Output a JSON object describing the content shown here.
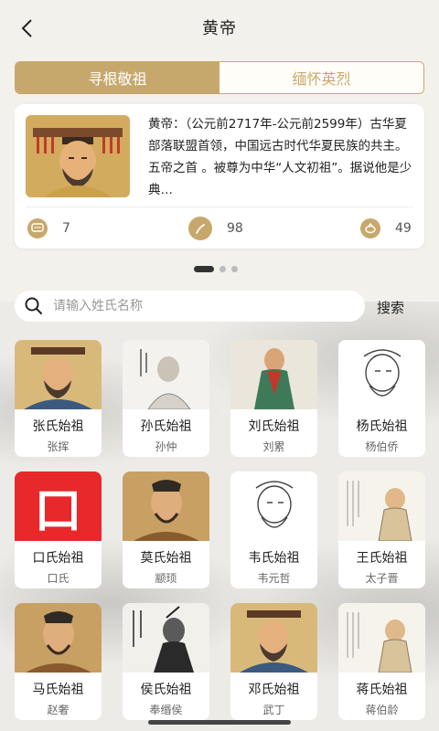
{
  "header": {
    "title": "黄帝"
  },
  "tabs": [
    {
      "label": "寻根敬祖"
    },
    {
      "label": "缅怀英烈"
    }
  ],
  "featured": {
    "description": "黄帝：（公元前2717年-公元前2599年）古华夏部落联盟首领，中国远古时代华夏民族的共主。五帝之首 。被尊为中华“人文初祖”。据说他是少典…",
    "stats": {
      "comments": "7",
      "likes": "98",
      "flowers": "49"
    }
  },
  "search": {
    "placeholder": "请输入姓氏名称",
    "button": "搜索"
  },
  "ancestors": [
    {
      "name": "张氏始祖",
      "person": "张挥",
      "art": "emperor"
    },
    {
      "name": "孙氏始祖",
      "person": "孙仲",
      "art": "sketch"
    },
    {
      "name": "刘氏始祖",
      "person": "刘累",
      "art": "robe"
    },
    {
      "name": "杨氏始祖",
      "person": "杨伯侨",
      "art": "lineart"
    },
    {
      "name": "口氏始祖",
      "person": "口氏",
      "art": "red-glyph",
      "glyph": "口"
    },
    {
      "name": "莫氏始祖",
      "person": "颛顼",
      "art": "painted"
    },
    {
      "name": "韦氏始祖",
      "person": "韦元哲",
      "art": "lineart"
    },
    {
      "name": "王氏始祖",
      "person": "太子晋",
      "art": "book"
    },
    {
      "name": "马氏始祖",
      "person": "赵奢",
      "art": "painted"
    },
    {
      "name": "侯氏始祖",
      "person": "奉缗侯",
      "art": "ink"
    },
    {
      "name": "邓氏始祖",
      "person": "武丁",
      "art": "emperor"
    },
    {
      "name": "蒋氏始祖",
      "person": "蒋伯龄",
      "art": "book"
    }
  ],
  "colors": {
    "accent": "#c7a86c",
    "glyph_red": "#e8282b"
  }
}
